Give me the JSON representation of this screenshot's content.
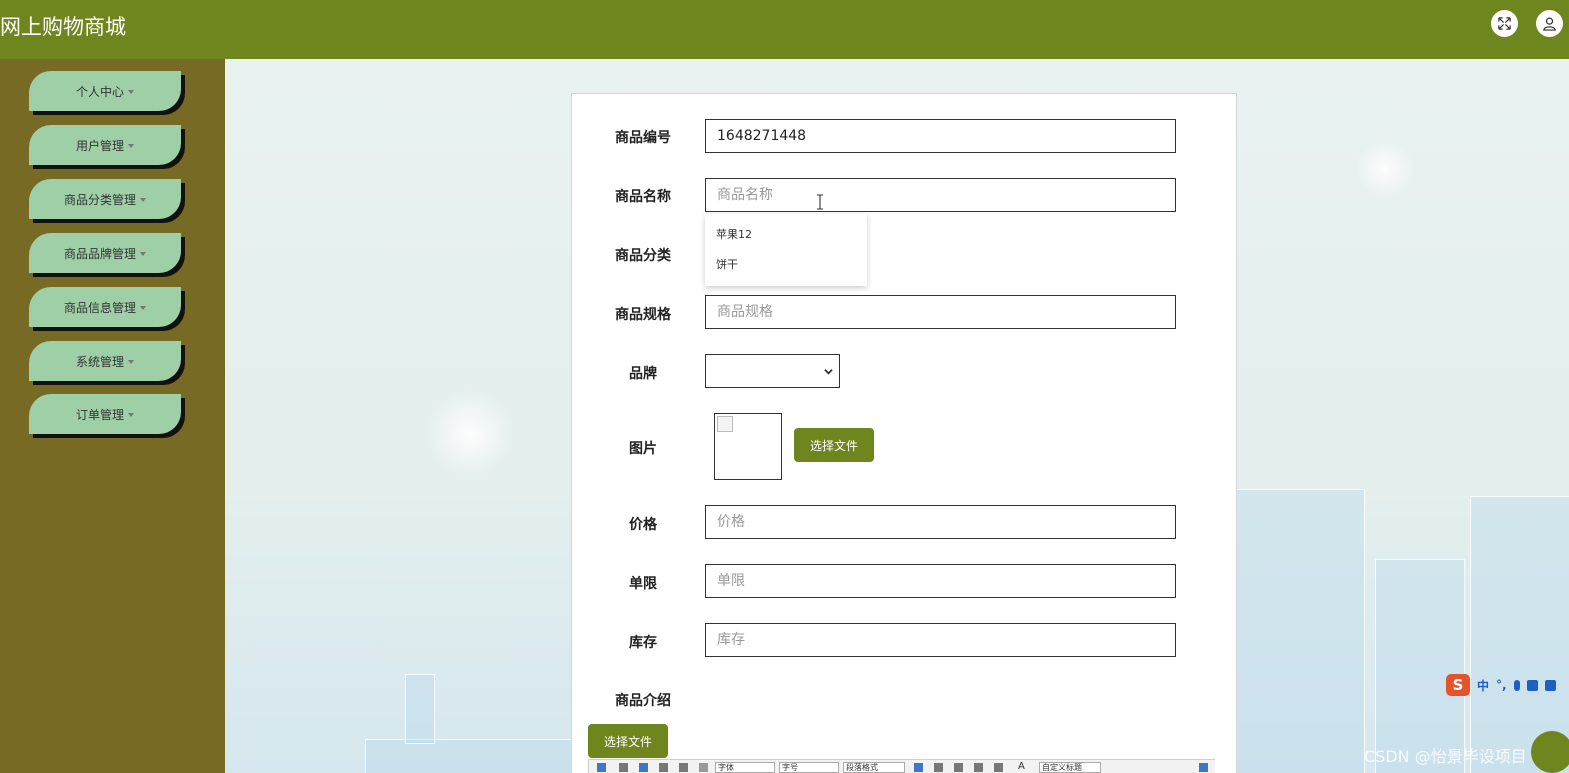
{
  "header": {
    "title": "网上购物商城",
    "fullscreen_icon": "expand-icon",
    "user_icon": "user-icon"
  },
  "sidebar": {
    "items": [
      {
        "label": "个人中心"
      },
      {
        "label": "用户管理"
      },
      {
        "label": "商品分类管理"
      },
      {
        "label": "商品品牌管理"
      },
      {
        "label": "商品信息管理"
      },
      {
        "label": "系统管理"
      },
      {
        "label": "订单管理"
      }
    ]
  },
  "form": {
    "code_label": "商品编号",
    "code_value": "1648271448",
    "name_label": "商品名称",
    "name_placeholder": "商品名称",
    "category_label": "商品分类",
    "category_options": [
      "苹果12",
      "饼干"
    ],
    "spec_label": "商品规格",
    "spec_placeholder": "商品规格",
    "brand_label": "品牌",
    "brand_value": "",
    "image_label": "图片",
    "choose_file": "选择文件",
    "price_label": "价格",
    "price_placeholder": "价格",
    "limit_label": "单限",
    "limit_placeholder": "单限",
    "stock_label": "库存",
    "stock_placeholder": "库存",
    "intro_label": "商品介绍",
    "intro_choose_file": "选择文件"
  },
  "editor_toolbar": {
    "font_family": "字体",
    "font_size": "字号",
    "paragraph": "段落格式",
    "custom_title": "自定义标题",
    "text_color": "A"
  },
  "ime": {
    "logo": "S",
    "mode": "中",
    "punct": "°,"
  },
  "watermark": "CSDN @怡景毕设项目"
}
